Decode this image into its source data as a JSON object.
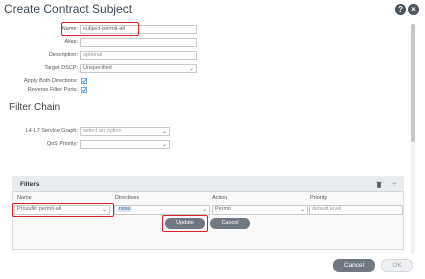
{
  "dialog": {
    "title": "Create Contract Subject",
    "help_icon": "help-icon",
    "close_icon": "close-icon"
  },
  "form": {
    "name": {
      "label": "Name:",
      "value": "subject-permit-all"
    },
    "alias": {
      "label": "Alias:",
      "value": ""
    },
    "description": {
      "label": "Description:",
      "placeholder": "optional"
    },
    "target_dscp": {
      "label": "Target DSCP:",
      "value": "Unspecified"
    },
    "apply_both_directions": {
      "label": "Apply Both Directions:",
      "checked": true
    },
    "reverse_filter_ports": {
      "label": "Reverse Filter Ports:",
      "checked": true
    }
  },
  "filter_chain": {
    "title": "Filter Chain",
    "service_graph": {
      "label": "L4-L7 Service Graph:",
      "placeholder": "select an option"
    },
    "qos_priority": {
      "label": "QoS Priority:",
      "value": ""
    }
  },
  "filters": {
    "title": "Filters",
    "columns": [
      "Name",
      "Directives",
      "Action",
      "Priority"
    ],
    "row": {
      "name": "Proxufiir permit-all",
      "directive": "none",
      "action": "Permit",
      "priority_placeholder": "default level"
    },
    "update_label": "Update",
    "cancel_label": "Cancel",
    "delete_icon": "trash-icon",
    "add_icon": "plus-icon"
  },
  "footer": {
    "cancel_label": "Cancel",
    "ok_label": "OK"
  },
  "colors": {
    "highlight": "#d8232a",
    "check": "#2b7bd6"
  }
}
